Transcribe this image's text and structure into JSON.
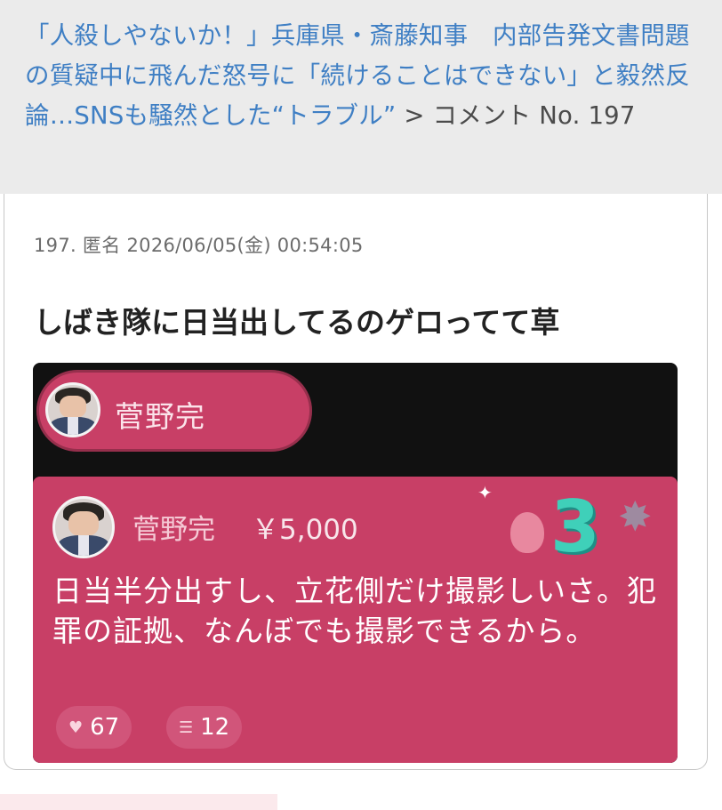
{
  "header": {
    "title_line": "「人殺しやないか！」兵庫県・斎藤知事　内部告発文書問題の質疑中に飛んだ怒号に「続けることはできない」と毅然反論…SNSも騒然とした“トラブル”",
    "separator": " > ",
    "section": "コメント No. 197"
  },
  "comment": {
    "meta": "197. 匿名 2026/06/05(金) 00:54:05",
    "body": "しばき隊に日当出してるのゲロってて草"
  },
  "embed": {
    "pill_name": "菅野完",
    "superchat": {
      "name": "菅野完",
      "amount": "￥5,000",
      "message": "日当半分出すし、立花側だけ撮影しいさ。犯罪の証拠、なんぼでも撮影できるから。",
      "likes": "67",
      "replies": "12",
      "rank": "3"
    },
    "colors": {
      "panel": "#c83f66",
      "background": "#111111",
      "rank_digit": "#3fd0b9"
    },
    "icons": [
      "avatar-icon",
      "like-icon",
      "reply-icon",
      "balloon-icon",
      "star-icon",
      "sparkle-icon"
    ]
  }
}
